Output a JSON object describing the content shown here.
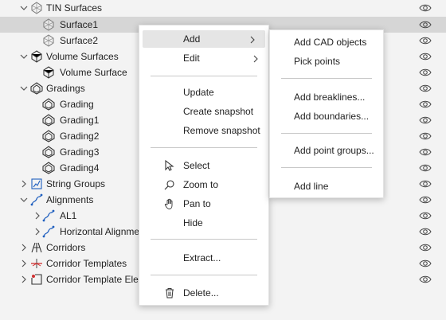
{
  "tree": {
    "items": [
      {
        "label": "TIN Surfaces",
        "expander": "expanded",
        "icon": "tin-surface-icon"
      },
      {
        "label": "Surface1",
        "expander": "none",
        "icon": "surface-icon",
        "selected": true
      },
      {
        "label": "Surface2",
        "expander": "none",
        "icon": "surface-icon"
      },
      {
        "label": "Volume Surfaces",
        "expander": "expanded",
        "icon": "volume-surface-icon"
      },
      {
        "label": "Volume Surface",
        "expander": "none",
        "icon": "volume-surface-icon"
      },
      {
        "label": "Gradings",
        "expander": "expanded",
        "icon": "grading-icon"
      },
      {
        "label": "Grading",
        "expander": "none",
        "icon": "grading-icon"
      },
      {
        "label": "Grading1",
        "expander": "none",
        "icon": "grading-icon"
      },
      {
        "label": "Grading2",
        "expander": "none",
        "icon": "grading-icon"
      },
      {
        "label": "Grading3",
        "expander": "none",
        "icon": "grading-icon"
      },
      {
        "label": "Grading4",
        "expander": "none",
        "icon": "grading-icon"
      },
      {
        "label": "String Groups",
        "expander": "collapsed",
        "icon": "string-group-icon"
      },
      {
        "label": "Alignments",
        "expander": "expanded",
        "icon": "alignment-icon"
      },
      {
        "label": "AL1",
        "expander": "collapsed",
        "icon": "alignment-icon"
      },
      {
        "label": "Horizontal Alignmer",
        "expander": "collapsed",
        "icon": "alignment-icon"
      },
      {
        "label": "Corridors",
        "expander": "collapsed",
        "icon": "corridor-icon"
      },
      {
        "label": "Corridor Templates",
        "expander": "collapsed",
        "icon": "corridor-template-icon"
      },
      {
        "label": "Corridor Template Elem",
        "expander": "collapsed",
        "icon": "corridor-template-element-icon"
      }
    ]
  },
  "context_menu": {
    "items": [
      {
        "label": "Add",
        "submenu": true,
        "highlighted": true
      },
      {
        "label": "Edit",
        "submenu": true
      },
      {
        "label": "Update"
      },
      {
        "label": "Create snapshot"
      },
      {
        "label": "Remove snapshot"
      },
      {
        "label": "Select",
        "icon": "select-cursor-icon"
      },
      {
        "label": "Zoom to",
        "icon": "zoom-icon"
      },
      {
        "label": "Pan to",
        "icon": "pan-hand-icon"
      },
      {
        "label": "Hide"
      },
      {
        "label": "Extract..."
      },
      {
        "label": "Delete...",
        "icon": "trash-icon"
      }
    ]
  },
  "submenu": {
    "items": [
      {
        "label": "Add CAD objects"
      },
      {
        "label": "Pick points"
      },
      {
        "label": "Add breaklines..."
      },
      {
        "label": "Add boundaries..."
      },
      {
        "label": "Add point groups..."
      },
      {
        "label": "Add line"
      }
    ]
  },
  "colors": {
    "background": "#f3f3f3",
    "selected_row": "#d6d6d6",
    "menu_bg": "#ffffff",
    "menu_hover": "#e5e5e5",
    "icon_gray": "#555555",
    "icon_blue": "#1f5fbf",
    "icon_red": "#d03030"
  }
}
